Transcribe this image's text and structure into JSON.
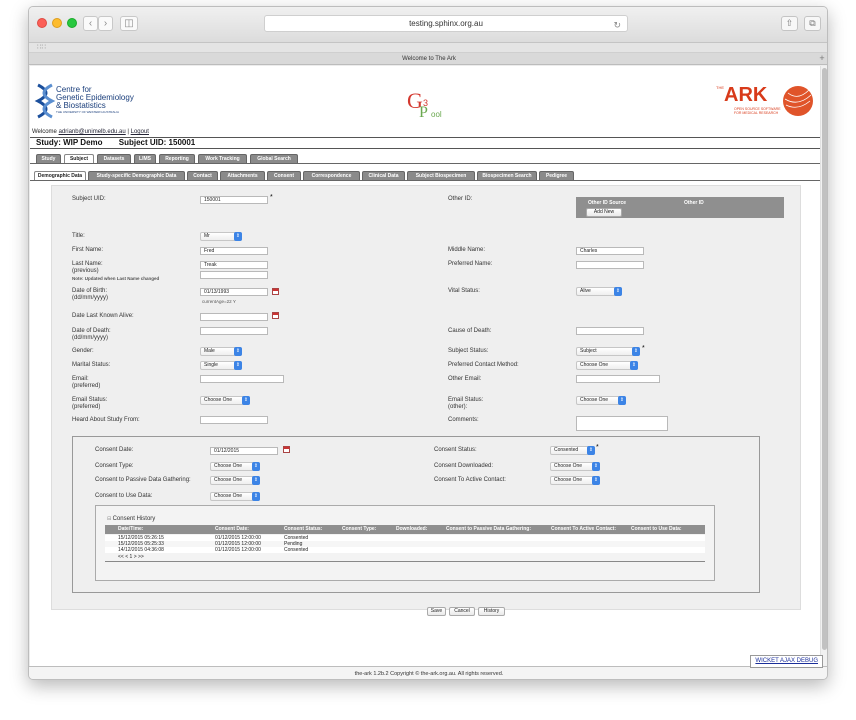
{
  "browser": {
    "url": "testing.sphinx.org.au",
    "tab_title": "Welcome to The Ark"
  },
  "header": {
    "logo_left": [
      "Centre for",
      "Genetic Epidemiology",
      "& Biostatistics",
      "THE UNIVERSITY OF WESTERN AUSTRALIA"
    ],
    "logo_center_g": "G",
    "logo_center_3": "3",
    "logo_center_p": "P",
    "logo_center_ool": "ool",
    "logo_right_the": "THE",
    "logo_right_ark": "ARK",
    "logo_right_sub": [
      "OPEN SOURCE SOFTWARE",
      "FOR MEDICAL RESEARCH"
    ],
    "welcome": "Welcome",
    "user": "adrianb@unimelb.edu.au",
    "separator": "|",
    "logout": "Logout",
    "study": "Study: WIP Demo",
    "subject_uid_title": "Subject UID: 150001"
  },
  "tabs_main": [
    "Study",
    "Subject",
    "Datasets",
    "LIMS",
    "Reporting",
    "Work Tracking",
    "Global Search"
  ],
  "tabs_sub": [
    "Demographic Data",
    "Study-specific Demographic Data",
    "Contact",
    "Attachments",
    "Consent",
    "Correspondence",
    "Clinical Data",
    "Subject Biospecimen",
    "Biospecimen Search",
    "Pedigree"
  ],
  "form": {
    "subject_uid_label": "Subject UID:",
    "subject_uid_value": "150001",
    "other_id_label": "Other ID:",
    "other_id_source_header": "Other ID Source",
    "other_id_header": "Other ID",
    "add_new": "Add New",
    "title_label": "Title:",
    "title_value": "Mr",
    "first_name_label": "First Name:",
    "first_name_value": "Fred",
    "middle_name_label": "Middle Name:",
    "middle_name_value": "Charles",
    "last_name_label": "Last Name:",
    "last_name_value": "Treak",
    "previous_label": "(previous)",
    "note": "Note: Updated when Last Name changed",
    "preferred_name_label": "Preferred Name:",
    "dob_label": "Date of Birth:",
    "dob_format": "(dd/mm/yyyy)",
    "dob_value": "01/13/1993",
    "current_age": "currentAge=22 Y",
    "vital_status_label": "Vital Status:",
    "vital_status_value": "Alive",
    "last_known_alive_label": "Date Last Known Alive:",
    "dod_label": "Date of Death:",
    "dod_format": "(dd/mm/yyyy)",
    "cause_of_death_label": "Cause of Death:",
    "gender_label": "Gender:",
    "gender_value": "Male",
    "subject_status_label": "Subject Status:",
    "subject_status_value": "Subject",
    "marital_label": "Marital Status:",
    "marital_value": "Single",
    "preferred_contact_label": "Preferred Contact Method:",
    "preferred_contact_value": "Choose One",
    "email_label": "Email:",
    "email_preferred": "(preferred)",
    "other_email_label": "Other Email:",
    "email_status_label": "Email Status:",
    "email_status_preferred": "(preferred)",
    "email_status_value": "Choose One",
    "email_status_other_label": "Email Status:",
    "email_status_other_sub": "(other):",
    "email_status_other_value": "Choose One",
    "heard_about_label": "Heard About Study From:",
    "comments_label": "Comments:"
  },
  "consent": {
    "consent_date_label": "Consent Date:",
    "consent_date_value": "01/12/2015",
    "consent_status_label": "Consent Status:",
    "consent_status_value": "Consented",
    "consent_type_label": "Consent Type:",
    "consent_type_value": "Choose One",
    "consent_downloaded_label": "Consent Downloaded:",
    "consent_downloaded_value": "Choose One",
    "passive_label": "Consent to Passive Data Gathering:",
    "passive_value": "Choose One",
    "active_label": "Consent To Active Contact:",
    "active_value": "Choose One",
    "use_data_label": "Consent to Use Data:",
    "use_data_value": "Choose One",
    "history_title": "Consent History",
    "history_columns": [
      "Date/Time:",
      "Consent Date:",
      "Consent Status:",
      "Consent Type:",
      "Downloaded:",
      "Consent to Passive Data Gathering:",
      "Consent To Active Contact:",
      "Consent to Use Data:"
    ],
    "history_rows": [
      [
        "15/12/2015 05:26:15",
        "01/12/2015 12:00:00",
        "Consented"
      ],
      [
        "15/12/2015 05:25:33",
        "01/12/2015 12:00:00",
        "Pending"
      ],
      [
        "14/12/2015 04:36:08",
        "01/12/2015 12:00:00",
        "Consented"
      ]
    ],
    "pager": "<< < 1 > >>"
  },
  "actions": [
    "Save",
    "Cancel",
    "History"
  ],
  "footer": {
    "copyright": "the-ark 1.2b.2 Copyright © the-ark.org.au. All rights reserved.",
    "debug": "WICKET AJAX DEBUG"
  },
  "colors": {
    "accent_blue": "#3c84e6",
    "tab_grey": "#8a8a8a",
    "ark_red": "#d83a1a"
  }
}
